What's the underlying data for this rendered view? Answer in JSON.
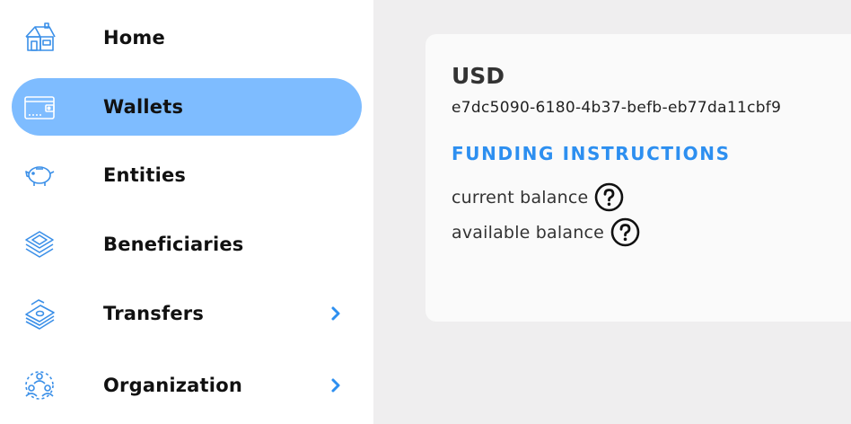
{
  "sidebar": {
    "items": [
      {
        "label": "Home",
        "icon": "house-icon"
      },
      {
        "label": "Wallets",
        "icon": "wallet-icon",
        "active": true
      },
      {
        "label": "Entities",
        "icon": "piggy-bank-icon"
      },
      {
        "label": "Beneficiaries",
        "icon": "layers-icon"
      },
      {
        "label": "Transfers",
        "icon": "money-stack-icon",
        "chevron": "chevron-right-icon"
      },
      {
        "label": "Organization",
        "icon": "people-group-icon",
        "chevron": "chevron-right-icon"
      }
    ]
  },
  "wallet": {
    "currency": "USD",
    "id": "e7dc5090-6180-4b37-befb-eb77da11cbf9",
    "funding_label": "FUNDING INSTRUCTIONS",
    "current_balance_label": "current balance",
    "available_balance_label": "available balance"
  },
  "colors": {
    "accent": "#2d8ff0",
    "active_nav": "#7ebcff",
    "icon_blue": "#3a8fe8",
    "background": "#efeeef",
    "card": "#fafafa"
  }
}
